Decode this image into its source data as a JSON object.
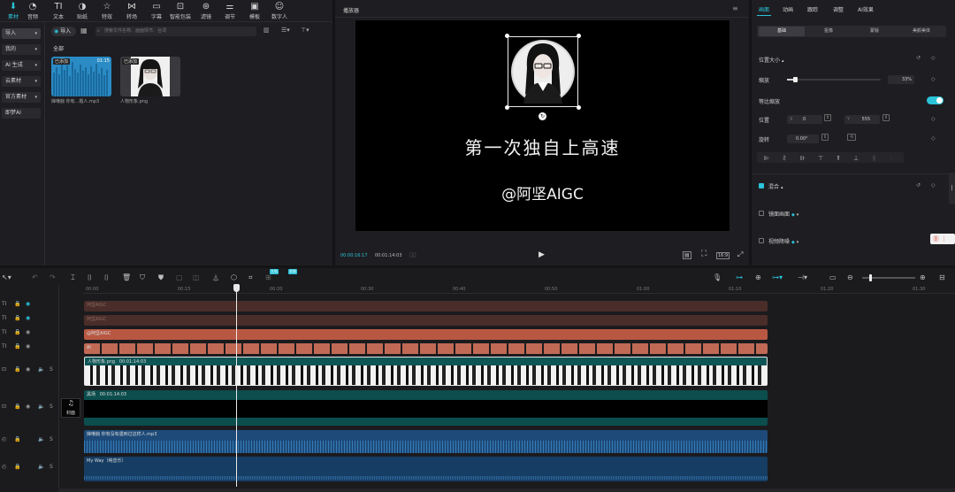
{
  "toolbar": {
    "items": [
      {
        "icon": "import-icon",
        "label": "素材",
        "active": true
      },
      {
        "icon": "audio-icon",
        "label": "音频"
      },
      {
        "icon": "text-icon",
        "label": "文本"
      },
      {
        "icon": "sticker-icon",
        "label": "贴纸"
      },
      {
        "icon": "effects-icon",
        "label": "特效"
      },
      {
        "icon": "transition-icon",
        "label": "转场"
      },
      {
        "icon": "subtitle-icon",
        "label": "字幕"
      },
      {
        "icon": "smart-package-icon",
        "label": "智能包装"
      },
      {
        "icon": "filter-icon",
        "label": "滤镜"
      },
      {
        "icon": "adjust-icon",
        "label": "调节"
      },
      {
        "icon": "template-icon",
        "label": "模板"
      },
      {
        "icon": "digital-human-icon",
        "label": "数字人"
      }
    ]
  },
  "sidebar": {
    "items": [
      {
        "label": "导入",
        "chevron": true,
        "active": true
      },
      {
        "label": "我的",
        "chevron": true
      },
      {
        "label": "AI 生成",
        "chevron": true
      },
      {
        "label": "云素材",
        "chevron": true
      },
      {
        "label": "官方素材",
        "chevron": true
      },
      {
        "label": "即梦AI",
        "chevron": false
      }
    ]
  },
  "media": {
    "import_label": "导入",
    "search_placeholder": "搜索文件名称、画面情节、台词",
    "section": "全部",
    "items": [
      {
        "badge": "已添加",
        "duration": "01:15",
        "name": "婵嗛搧 你有...婚人.mp3"
      },
      {
        "badge": "已添加",
        "name": "人物形象.png"
      }
    ]
  },
  "player": {
    "title": "播放器",
    "caption": "第一次独自上高速",
    "watermark": "@阿坚AIGC",
    "current_time": "00:00:16:17",
    "total_time": "00:01:14:03",
    "ratio": "16:9"
  },
  "inspector": {
    "tabs": [
      "画面",
      "动画",
      "跟踪",
      "调整",
      "AI效果"
    ],
    "subtabs": [
      "基础",
      "抠像",
      "蒙版",
      "美颜美体"
    ],
    "position_size": "位置大小",
    "scale_label": "缩放",
    "scale_value": "33%",
    "scale_fraction": 0.33,
    "uniform_scale": "等比缩放",
    "position_label": "位置",
    "x_label": "X",
    "x_value": "0",
    "y_label": "Y",
    "y_value": "555",
    "rotate_label": "旋转",
    "rotate_value": "0.00°",
    "blend_label": "混合",
    "bg_fill_label": "镜面画面",
    "video_stab_label": "视频降噪"
  },
  "timeline": {
    "ruler": [
      "00:00",
      "00:15",
      "00:20",
      "00:30",
      "00:40",
      "00:50",
      "01:00",
      "01:10",
      "01:20",
      "01:30"
    ],
    "tracks": {
      "text1": "阿坚AIGC",
      "text2": "阿坚AIGC",
      "text3": "@阿坚AIGC",
      "tts_chip": "AI",
      "video_label": "人物形象.png",
      "video_duration": "00:01:14:03",
      "cover_label": "封面",
      "bg_label": "黑场",
      "bg_duration": "00:01:14:03",
      "audio1_label": "婵嗛搧 你有没有遇到过这样人.mp3",
      "audio2_label": "My Way（纯音乐）"
    },
    "badges": [
      "主轨",
      "关联"
    ]
  },
  "colors": {
    "accent": "#2bc3d9",
    "text_clip": "#5a3a35",
    "main_text_clip": "#b85843",
    "video_clip": "#0e5656",
    "audio_clip": "#1d4a78"
  }
}
